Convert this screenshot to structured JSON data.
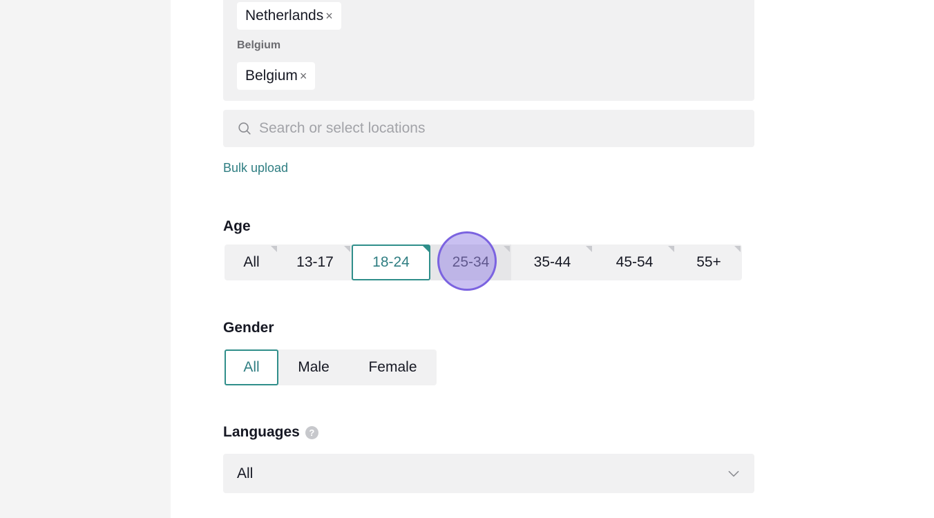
{
  "locations": {
    "groups": [
      {
        "chips": [
          {
            "label": "Netherlands",
            "remove": "×"
          }
        ]
      },
      {
        "group_label": "Belgium",
        "chips": [
          {
            "label": "Belgium",
            "remove": "×"
          }
        ]
      }
    ],
    "search_placeholder": "Search or select locations",
    "bulk_upload": "Bulk upload"
  },
  "age": {
    "title": "Age",
    "options": [
      "All",
      "13-17",
      "18-24",
      "25-34",
      "35-44",
      "45-54",
      "55+"
    ],
    "selected": "18-24",
    "hovered": "25-34"
  },
  "gender": {
    "title": "Gender",
    "options": [
      "All",
      "Male",
      "Female"
    ],
    "selected": "All"
  },
  "languages": {
    "title": "Languages",
    "help_icon": "question-icon",
    "value": "All"
  },
  "colors": {
    "accent": "#2f8e8a",
    "link": "#2f7e82",
    "field_bg": "#f1f1f2",
    "click_marker": "#7b63e0"
  }
}
